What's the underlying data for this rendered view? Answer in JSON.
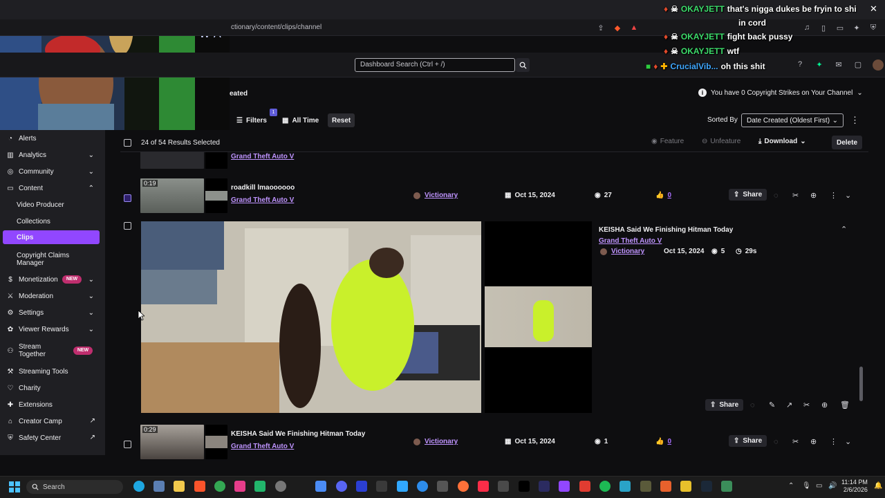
{
  "browser": {
    "url": "ctionary/content/clips/channel"
  },
  "topbar": {
    "search_placeholder": "Dashboard Search (Ctrl + /)"
  },
  "header": {
    "title_fragment": "eated",
    "strikes_text": "You have 0 Copyright Strikes on Your Channel"
  },
  "filters": {
    "filters_label": "Filters",
    "filters_count": "1",
    "time_label": "All Time",
    "reset_label": "Reset",
    "sorted_by_label": "Sorted By",
    "sort_value": "Date Created (Oldest First)"
  },
  "selection": {
    "text": "24 of 54 Results Selected",
    "feature_label": "Feature",
    "unfeature_label": "Unfeature",
    "download_label": "Download",
    "delete_label": "Delete"
  },
  "sidebar": {
    "items": [
      {
        "label": "Alerts",
        "icon": "bell-icon"
      },
      {
        "label": "Analytics",
        "icon": "chart-icon"
      },
      {
        "label": "Community",
        "icon": "people-icon"
      },
      {
        "label": "Content",
        "icon": "content-icon"
      },
      {
        "label": "Video Producer"
      },
      {
        "label": "Collections"
      },
      {
        "label": "Clips"
      },
      {
        "label": "Copyright Claims",
        "label2": "Manager"
      },
      {
        "label": "Monetization",
        "icon": "money-icon",
        "badge": "NEW"
      },
      {
        "label": "Moderation",
        "icon": "sword-icon"
      },
      {
        "label": "Settings",
        "icon": "gear-icon"
      },
      {
        "label": "Viewer Rewards",
        "icon": "gift-icon"
      },
      {
        "label": "Stream",
        "label2": "Together",
        "icon": "group-icon",
        "badge": "NEW"
      },
      {
        "label": "Streaming Tools",
        "icon": "tools-icon"
      },
      {
        "label": "Charity",
        "icon": "heart-icon"
      },
      {
        "label": "Extensions",
        "icon": "puzzle-icon"
      },
      {
        "label": "Creator Camp",
        "icon": "camp-icon"
      },
      {
        "label": "Safety Center",
        "icon": "shield-icon"
      }
    ]
  },
  "clips": [
    {
      "title": "",
      "game": "Grand Theft Auto V",
      "creator": "",
      "date": "",
      "views": "",
      "likes": ""
    },
    {
      "title": "roadkill lmaoooooo",
      "game": "Grand Theft Auto V",
      "duration": "0:19",
      "creator": "Victionary",
      "date": "Oct 15, 2024",
      "views": "27",
      "likes": "0",
      "share": "Share"
    },
    {
      "title": "KEISHA Said We Finishing Hitman Today",
      "game": "Grand Theft Auto V",
      "duration": "0:29",
      "creator": "Victionary",
      "date": "Oct 15, 2024",
      "views": "1",
      "likes": "0",
      "share": "Share"
    }
  ],
  "expanded": {
    "title": "KEISHA Said We Finishing Hitman Today",
    "game": "Grand Theft Auto V",
    "creator": "Victionary",
    "date": "Oct 15, 2024",
    "views": "5",
    "length": "29s",
    "share": "Share"
  },
  "chat": [
    {
      "user": "OKAYJETT",
      "msg": "that's nigga dukes be fryin to shi"
    },
    {
      "user": "",
      "msg": "in cord"
    },
    {
      "user": "OKAYJETT",
      "msg": "fight back pussy"
    },
    {
      "user": "OKAYJETT",
      "msg": "wtf"
    },
    {
      "user": "CrucialVib...",
      "msg": "oh this shit"
    }
  ],
  "taskbar": {
    "search": "Search",
    "time": "11:14 PM",
    "date": "2/6/2026"
  },
  "colors": {
    "accent": "#9147ff",
    "link": "#bf94ff",
    "background": "#0e0e10"
  }
}
